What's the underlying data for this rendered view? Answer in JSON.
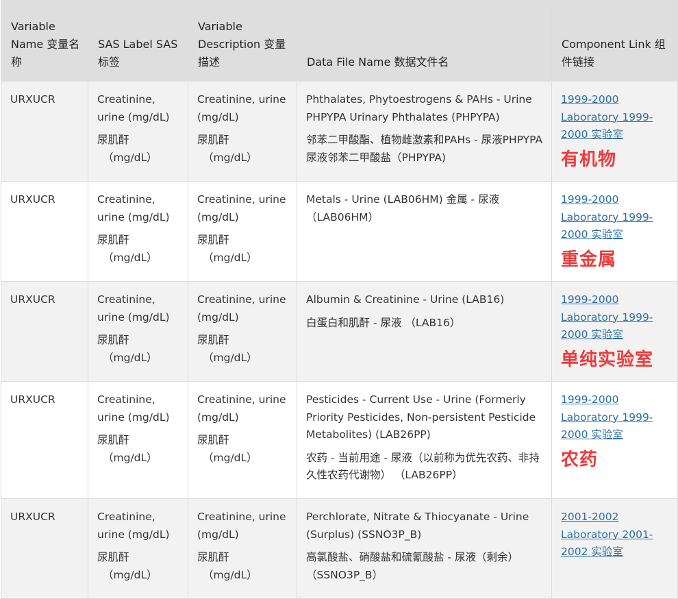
{
  "headers": {
    "var_name": "Variable Name  变量名称",
    "sas_label": "SAS Label  SAS标签",
    "var_desc": "Variable Description  变量描述",
    "data_file": "Data File Name  数据文件名",
    "component": "Component Link  组件链接"
  },
  "rows": [
    {
      "var": "URXUCR",
      "label_en": "Creatinine, urine (mg/dL)",
      "label_zh": "尿肌酐",
      "label_unit": "（mg/dL）",
      "desc_en": "Creatinine, urine (mg/dL)",
      "desc_zh": "尿肌酐",
      "desc_unit": "（mg/dL）",
      "file_en": "Phthalates, Phytoestrogens & PAHs - Urine PHPYPA Urinary Phthalates (PHPYPA)",
      "file_zh": "邻苯二甲酸酯、植物雌激素和PAHs - 尿液PHPYPA尿液邻苯二甲酸盐（PHPYPA)",
      "link": "1999-2000 Laboratory  1999-2000 实验室",
      "tag": "有机物"
    },
    {
      "var": "URXUCR",
      "label_en": "Creatinine, urine (mg/dL)",
      "label_zh": "尿肌酐",
      "label_unit": "（mg/dL）",
      "desc_en": "Creatinine, urine (mg/dL)",
      "desc_zh": "尿肌酐",
      "desc_unit": "（mg/dL）",
      "file_en": "Metals - Urine (LAB06HM)   金属 - 尿液（LAB06HM）",
      "file_zh": "",
      "link": "1999-2000 Laboratory  1999-2000 实验室",
      "tag": "重金属"
    },
    {
      "var": "URXUCR",
      "label_en": "Creatinine, urine (mg/dL)",
      "label_zh": "尿肌酐",
      "label_unit": "（mg/dL）",
      "desc_en": "Creatinine, urine (mg/dL)",
      "desc_zh": "尿肌酐",
      "desc_unit": "（mg/dL）",
      "file_en": "Albumin & Creatinine - Urine (LAB16)",
      "file_zh": "白蛋白和肌酐 - 尿液 （LAB16）",
      "link": "1999-2000 Laboratory  1999-2000 实验室",
      "tag": "单纯实验室"
    },
    {
      "var": "URXUCR",
      "label_en": "Creatinine, urine (mg/dL)",
      "label_zh": "尿肌酐",
      "label_unit": "（mg/dL）",
      "desc_en": "Creatinine, urine (mg/dL)",
      "desc_zh": "尿肌酐",
      "desc_unit": "（mg/dL）",
      "file_en": "Pesticides - Current Use - Urine (Formerly Priority Pesticides, Non-persistent Pesticide Metabolites) (LAB26PP)",
      "file_zh": "农药 - 当前用途 - 尿液（以前称为优先农药、非持久性农药代谢物） （LAB26PP）",
      "link": "1999-2000 Laboratory  1999-2000 实验室",
      "tag": "农药"
    },
    {
      "var": "URXUCR",
      "label_en": "Creatinine, urine (mg/dL)",
      "label_zh": "尿肌酐",
      "label_unit": "（mg/dL）",
      "desc_en": "Creatinine, urine (mg/dL)",
      "desc_zh": "尿肌酐",
      "desc_unit": "（mg/dL）",
      "file_en": "Perchlorate, Nitrate & Thiocyanate - Urine (Surplus) (SSNO3P_B)",
      "file_zh": "高氯酸盐、硝酸盐和硫氰酸盐 - 尿液（剩余）（SSNO3P_B）",
      "link": "2001-2002 Laboratory  2001-2002 实验室",
      "tag": ""
    }
  ],
  "colors": {
    "header_bg": "#dedede",
    "stripe": "#f2f2f2",
    "link": "#2c6ea6",
    "tag": "#ee3b3b"
  }
}
